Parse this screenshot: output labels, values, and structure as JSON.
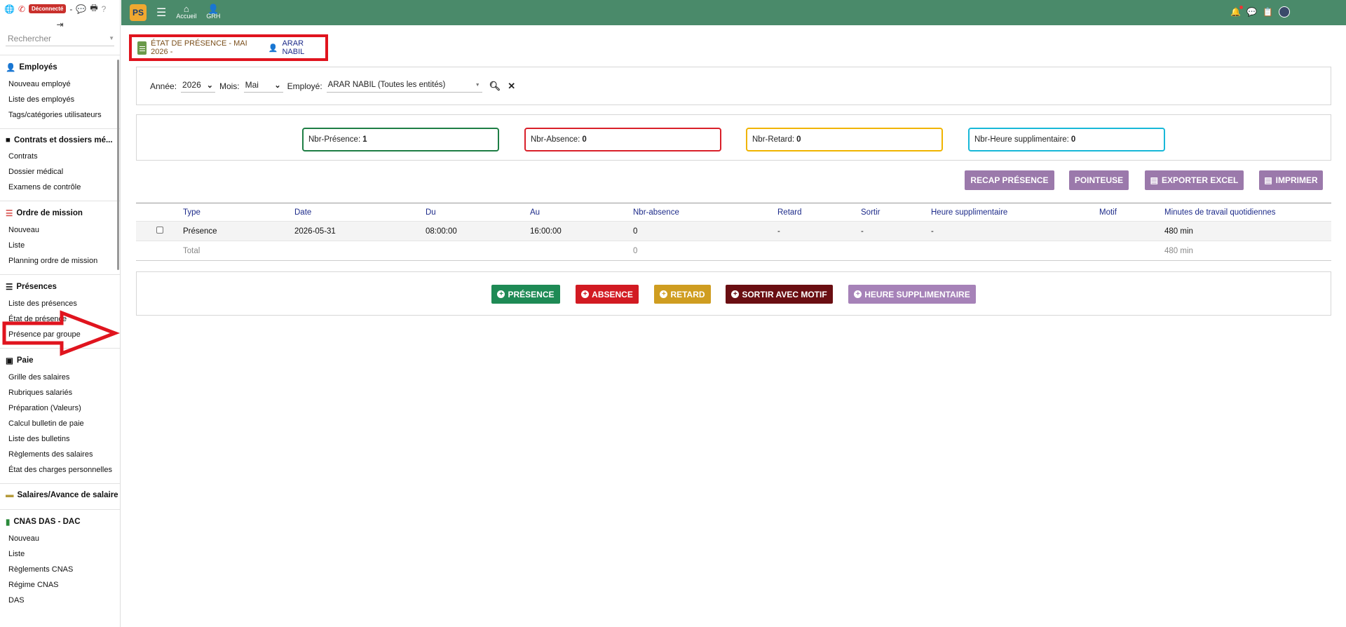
{
  "sidebar": {
    "disconnected_badge": "Déconnecté",
    "search_placeholder": "Rechercher",
    "sections": [
      {
        "title": "Employés",
        "items": [
          "Nouveau employé",
          "Liste des employés",
          "Tags/catégories utilisateurs"
        ]
      },
      {
        "title": "Contrats et dossiers mé...",
        "items": [
          "Contrats",
          "Dossier médical",
          "Examens de contrôle"
        ]
      },
      {
        "title": "Ordre de mission",
        "items": [
          "Nouveau",
          "Liste",
          "Planning ordre de mission"
        ]
      },
      {
        "title": "Présences",
        "items": [
          "Liste des présences",
          "État de présence",
          "Présence par groupe"
        ]
      },
      {
        "title": "Paie",
        "items": [
          "Grille des salaires",
          "Rubriques salariés",
          "Préparation (Valeurs)",
          "Calcul bulletin de paie",
          "Liste des bulletins",
          "Règlements des salaires",
          "État des charges personnelles"
        ]
      },
      {
        "title": "Salaires/Avance de salaire",
        "items": []
      },
      {
        "title": "CNAS DAS - DAC",
        "items": [
          "Nouveau",
          "Liste",
          "Règlements CNAS",
          "Régime CNAS",
          "DAS"
        ]
      }
    ]
  },
  "topbar": {
    "logo_text": "PS",
    "nav": [
      {
        "label": "Accueil",
        "icon": "home-icon"
      },
      {
        "label": "GRH",
        "icon": "user-icon"
      }
    ]
  },
  "header": {
    "title": "ÉTAT DE PRÉSENCE - MAI 2026 -",
    "user": "ARAR NABIL"
  },
  "filters": {
    "year_label": "Année:",
    "year_value": "2026",
    "month_label": "Mois:",
    "month_value": "Mai",
    "employee_label": "Employé:",
    "employee_value": "ARAR NABIL (Toutes les entités)"
  },
  "stats": [
    {
      "label": "Nbr-Présence:",
      "value": "1",
      "color": "#1e7e45"
    },
    {
      "label": "Nbr-Absence:",
      "value": "0",
      "color": "#d9202a"
    },
    {
      "label": "Nbr-Retard:",
      "value": "0",
      "color": "#f0b400"
    },
    {
      "label": "Nbr-Heure supplimentaire:",
      "value": "0",
      "color": "#18b8d8"
    }
  ],
  "actions": {
    "recap": "RECAP PRÉSENCE",
    "pointeuse": "POINTEUSE",
    "export": "EXPORTER EXCEL",
    "print": "IMPRIMER"
  },
  "table": {
    "headers": [
      "Type",
      "Date",
      "Du",
      "Au",
      "Nbr-absence",
      "Retard",
      "Sortir",
      "Heure supplimentaire",
      "Motif",
      "Minutes de travail quotidiennes"
    ],
    "rows": [
      [
        "Présence",
        "2026-05-31",
        "08:00:00",
        "16:00:00",
        "0",
        "-",
        "-",
        "-",
        "",
        "480 min"
      ]
    ],
    "total": {
      "label": "Total",
      "absence": "0",
      "minutes": "480 min"
    }
  },
  "add_buttons": {
    "presence": "PRÉSENCE",
    "absence": "ABSENCE",
    "retard": "RETARD",
    "sortir": "SORTIR AVEC MOTIF",
    "heure": "HEURE SUPPLIMENTAIRE"
  },
  "colors": {
    "topbar": "#4a8a6a",
    "presence": "#1e8a55",
    "absence": "#d21a22",
    "retard": "#cf9d20",
    "sortir": "#6a0e12",
    "heure": "#a682b8",
    "annotation": "#e0141e"
  }
}
